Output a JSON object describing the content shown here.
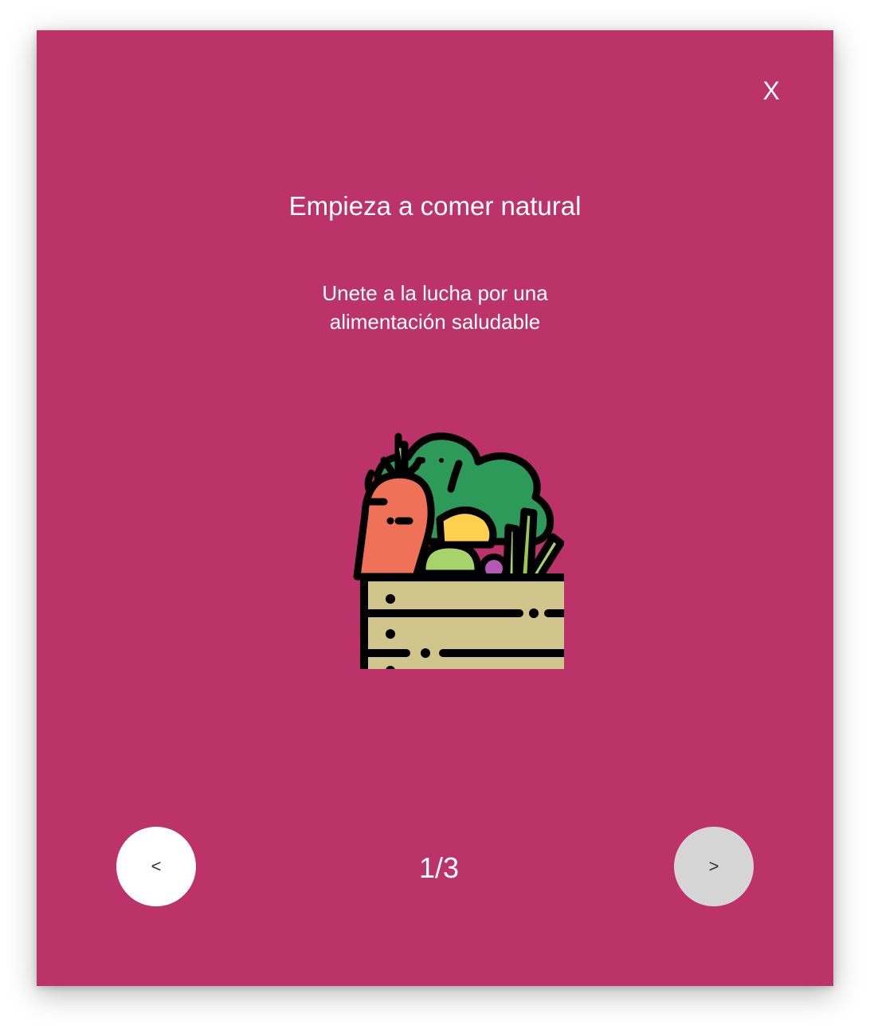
{
  "dialog": {
    "close_label": "X",
    "title": "Empieza a comer natural",
    "subtitle_lines": [
      "Unete a la lucha por una",
      "alimentación saludable"
    ],
    "illustration_icon": "vegetable-crate-icon"
  },
  "pagination": {
    "prev_label": "<",
    "next_label": ">",
    "indicator": "1/3"
  },
  "colors": {
    "background": "#bc336a",
    "prev_button": "#ffffff",
    "next_button": "#d6d6d6",
    "text": "#ffffff",
    "crate": "#d0c58a",
    "carrot": "#ee7158",
    "leaves": "#2e9a5a",
    "lemon": "#fdd14d",
    "lettuce": "#a7d36a",
    "radish": "#b45ab2"
  }
}
